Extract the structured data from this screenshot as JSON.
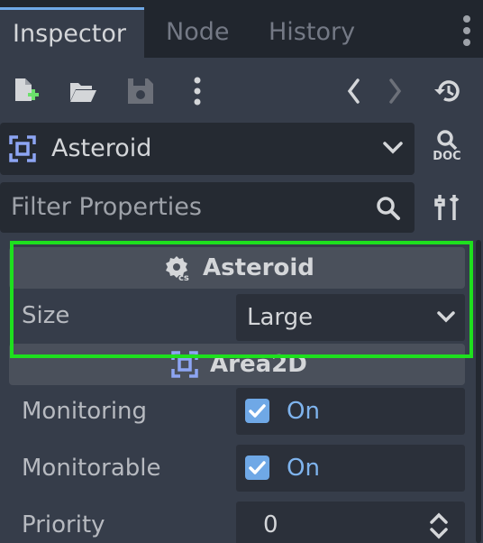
{
  "tabs": [
    {
      "label": "Inspector",
      "active": true
    },
    {
      "label": "Node",
      "active": false
    },
    {
      "label": "History",
      "active": false
    }
  ],
  "toolbar": {
    "new_resource_icon": "new-file-icon",
    "open_icon": "folder-open-icon",
    "save_icon": "save-icon",
    "more_icon": "vertical-ellipsis-icon",
    "back_icon": "chevron-left-icon",
    "forward_icon": "chevron-right-icon",
    "history_icon": "history-icon"
  },
  "object_selector": {
    "label": "Asteroid",
    "icon": "area2d-icon",
    "doc_label": "DOC"
  },
  "filter": {
    "placeholder": "Filter Properties"
  },
  "sections": {
    "script": {
      "title": "Asteroid",
      "icon": "csharp-script-icon",
      "properties": [
        {
          "label": "Size",
          "value": "Large"
        }
      ]
    },
    "area2d": {
      "title": "Area2D",
      "icon": "area2d-icon",
      "properties": [
        {
          "label": "Monitoring",
          "value": "On",
          "checked": true
        },
        {
          "label": "Monitorable",
          "value": "On",
          "checked": true
        },
        {
          "label": "Priority",
          "value": "0"
        }
      ]
    }
  },
  "colors": {
    "accent": "#6fa8e6",
    "highlight": "#1ee01e",
    "panel": "#363d4a",
    "field": "#252a32"
  }
}
